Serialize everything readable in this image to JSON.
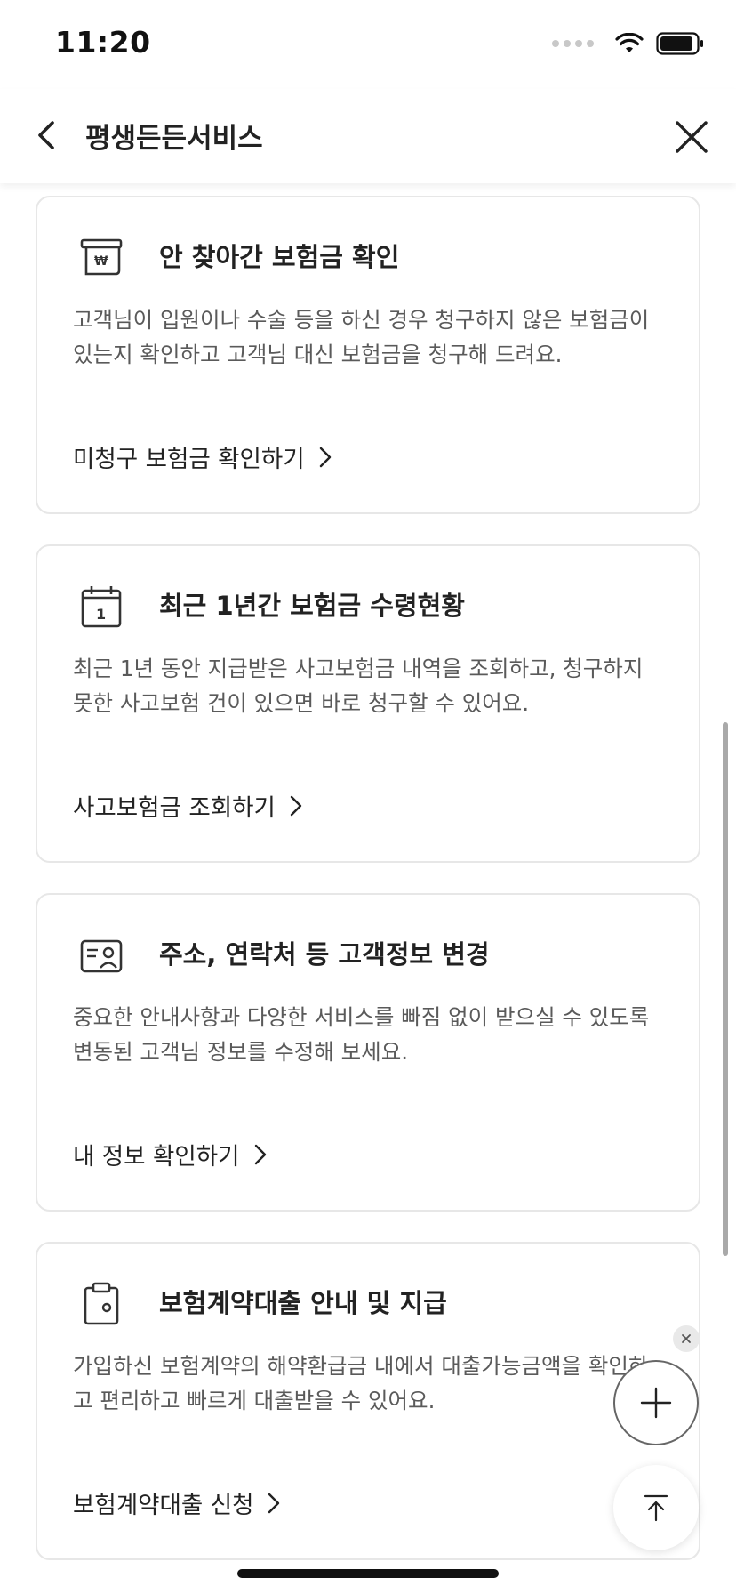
{
  "status_bar": {
    "time": "11:20"
  },
  "nav": {
    "title": "평생든든서비스"
  },
  "cards": [
    {
      "title": "안 찾아간 보험금 확인",
      "description": "고객님이 입원이나 수술 등을 하신 경우 청구하지 않은 보험금이 있는지 확인하고 고객님 대신 보험금을 청구해 드려요.",
      "link": "미청구 보험금 확인하기",
      "icon": "receipt-won-icon"
    },
    {
      "title": "최근 1년간 보험금 수령현황",
      "description": "최근 1년 동안 지급받은 사고보험금 내역을 조회하고, 청구하지 못한 사고보험 건이 있으면 바로 청구할 수 있어요.",
      "link": "사고보험금 조회하기",
      "icon": "calendar-icon"
    },
    {
      "title": "주소, 연락처 등 고객정보 변경",
      "description": "중요한 안내사항과 다양한 서비스를 빠짐 없이 받으실 수 있도록 변동된 고객님 정보를 수정해 보세요.",
      "link": "내 정보 확인하기",
      "icon": "id-card-icon"
    },
    {
      "title": "보험계약대출 안내 및 지급",
      "description": "가입하신 보험계약의 해약환급금 내에서 대출가능금액을 확인하고 편리하고 빠르게 대출받을 수 있어요.",
      "link": "보험계약대출 신청",
      "icon": "clipboard-icon"
    }
  ]
}
